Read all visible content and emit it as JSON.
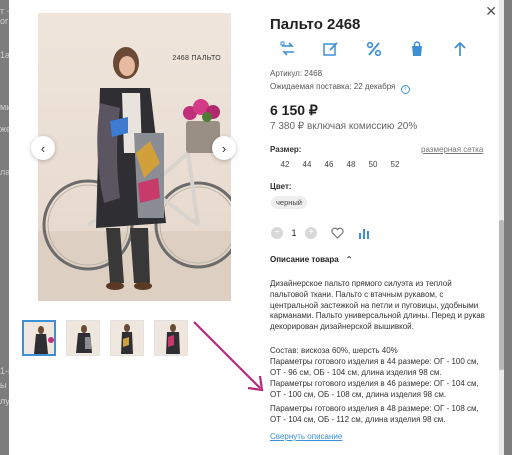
{
  "background": {
    "snippets": [
      "т - д",
      "ог -",
      "1а",
      "ми",
      "же",
      "ла",
      "1-м",
      "ы",
      "лу"
    ]
  },
  "product": {
    "title": "Пальто 2468",
    "photo_caption": "2468 ПАЛЬТО",
    "article_label": "Артикул:",
    "article_value": "2468",
    "delivery_label": "Ожидаемая поставка:",
    "delivery_value": "22 декабря",
    "price": "6 150 ₽",
    "price_with_commission": "7 380 ₽ включая комиссию 20%",
    "size_label": "Размер:",
    "size_chart_link": "размерная сетка",
    "sizes": [
      "42",
      "44",
      "46",
      "48",
      "50",
      "52"
    ],
    "color_label": "Цвет:",
    "color_value": "черный",
    "quantity": "1",
    "description_toggle": "Описание товара",
    "description_paragraphs": [
      "Дизайнерское пальто прямого силуэта из теплой пальтовой ткани. Пальто с втачным рукавом, с центральной застежкой на петли и пуговицы, удобными карманами. Пальто универсальной длины. Перед и рукав декорирован дизайнерской вышивкой.",
      "Состав: вискоза 60%, шерсть 40%",
      "Параметры готового изделия в 44 размере: ОГ - 100 см, ОТ - 96 см, ОБ - 104 см, длина изделия 98 см.",
      "Параметры готового изделия в 46 размере: ОГ - 104 см, ОТ - 100 см, ОБ - 108 см, длина изделия 98 см.",
      "Параметры готового изделия в 48 размере: ОГ - 108 см, ОТ - 104 см, ОБ - 112 см, длина изделия 98 см."
    ],
    "collapse_link": "Свернуть описание"
  },
  "icons": [
    "close-icon",
    "exchange-icon",
    "edit-icon",
    "percent-icon",
    "shopping-bag-icon",
    "arrow-up-icon",
    "chevron-left-icon",
    "chevron-right-icon",
    "info-icon",
    "heart-icon",
    "bar-chart-icon",
    "chevron-up-icon",
    "annotation-arrow-icon"
  ],
  "colors": {
    "accent": "#3d8fd6",
    "annotation_arrow": "#b5287a"
  }
}
